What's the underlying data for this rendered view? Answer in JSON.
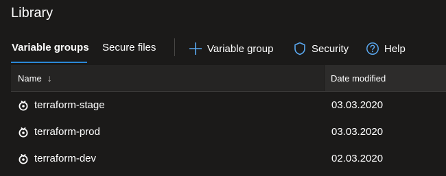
{
  "page": {
    "title": "Library"
  },
  "tabs": [
    {
      "label": "Variable groups",
      "active": true
    },
    {
      "label": "Secure files",
      "active": false
    }
  ],
  "commands": {
    "add_variable_group": {
      "label": "Variable group",
      "icon": "plus-icon"
    },
    "security": {
      "label": "Security",
      "icon": "shield-icon"
    },
    "help": {
      "label": "Help",
      "icon": "help-circle-icon"
    }
  },
  "table": {
    "columns": {
      "name": "Name",
      "name_sort": "↓",
      "date_modified": "Date modified"
    },
    "rows": [
      {
        "name": "terraform-stage",
        "date_modified": "03.03.2020",
        "icon": "variable-group-icon"
      },
      {
        "name": "terraform-prod",
        "date_modified": "03.03.2020",
        "icon": "variable-group-icon"
      },
      {
        "name": "terraform-dev",
        "date_modified": "02.03.2020",
        "icon": "variable-group-icon"
      }
    ]
  },
  "colors": {
    "background": "#1b1a19",
    "accent": "#2b88d8",
    "header_bg": "#252423",
    "text": "#ffffff"
  }
}
